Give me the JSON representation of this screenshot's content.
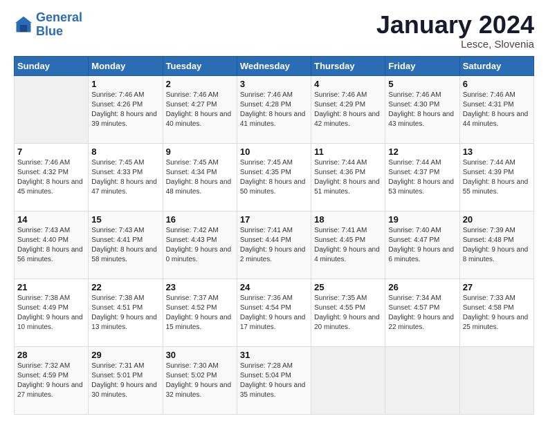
{
  "logo": {
    "line1": "General",
    "line2": "Blue"
  },
  "title": "January 2024",
  "location": "Lesce, Slovenia",
  "days_header": [
    "Sunday",
    "Monday",
    "Tuesday",
    "Wednesday",
    "Thursday",
    "Friday",
    "Saturday"
  ],
  "weeks": [
    [
      {
        "num": "",
        "sunrise": "",
        "sunset": "",
        "daylight": ""
      },
      {
        "num": "1",
        "sunrise": "Sunrise: 7:46 AM",
        "sunset": "Sunset: 4:26 PM",
        "daylight": "Daylight: 8 hours and 39 minutes."
      },
      {
        "num": "2",
        "sunrise": "Sunrise: 7:46 AM",
        "sunset": "Sunset: 4:27 PM",
        "daylight": "Daylight: 8 hours and 40 minutes."
      },
      {
        "num": "3",
        "sunrise": "Sunrise: 7:46 AM",
        "sunset": "Sunset: 4:28 PM",
        "daylight": "Daylight: 8 hours and 41 minutes."
      },
      {
        "num": "4",
        "sunrise": "Sunrise: 7:46 AM",
        "sunset": "Sunset: 4:29 PM",
        "daylight": "Daylight: 8 hours and 42 minutes."
      },
      {
        "num": "5",
        "sunrise": "Sunrise: 7:46 AM",
        "sunset": "Sunset: 4:30 PM",
        "daylight": "Daylight: 8 hours and 43 minutes."
      },
      {
        "num": "6",
        "sunrise": "Sunrise: 7:46 AM",
        "sunset": "Sunset: 4:31 PM",
        "daylight": "Daylight: 8 hours and 44 minutes."
      }
    ],
    [
      {
        "num": "7",
        "sunrise": "Sunrise: 7:46 AM",
        "sunset": "Sunset: 4:32 PM",
        "daylight": "Daylight: 8 hours and 45 minutes."
      },
      {
        "num": "8",
        "sunrise": "Sunrise: 7:45 AM",
        "sunset": "Sunset: 4:33 PM",
        "daylight": "Daylight: 8 hours and 47 minutes."
      },
      {
        "num": "9",
        "sunrise": "Sunrise: 7:45 AM",
        "sunset": "Sunset: 4:34 PM",
        "daylight": "Daylight: 8 hours and 48 minutes."
      },
      {
        "num": "10",
        "sunrise": "Sunrise: 7:45 AM",
        "sunset": "Sunset: 4:35 PM",
        "daylight": "Daylight: 8 hours and 50 minutes."
      },
      {
        "num": "11",
        "sunrise": "Sunrise: 7:44 AM",
        "sunset": "Sunset: 4:36 PM",
        "daylight": "Daylight: 8 hours and 51 minutes."
      },
      {
        "num": "12",
        "sunrise": "Sunrise: 7:44 AM",
        "sunset": "Sunset: 4:37 PM",
        "daylight": "Daylight: 8 hours and 53 minutes."
      },
      {
        "num": "13",
        "sunrise": "Sunrise: 7:44 AM",
        "sunset": "Sunset: 4:39 PM",
        "daylight": "Daylight: 8 hours and 55 minutes."
      }
    ],
    [
      {
        "num": "14",
        "sunrise": "Sunrise: 7:43 AM",
        "sunset": "Sunset: 4:40 PM",
        "daylight": "Daylight: 8 hours and 56 minutes."
      },
      {
        "num": "15",
        "sunrise": "Sunrise: 7:43 AM",
        "sunset": "Sunset: 4:41 PM",
        "daylight": "Daylight: 8 hours and 58 minutes."
      },
      {
        "num": "16",
        "sunrise": "Sunrise: 7:42 AM",
        "sunset": "Sunset: 4:43 PM",
        "daylight": "Daylight: 9 hours and 0 minutes."
      },
      {
        "num": "17",
        "sunrise": "Sunrise: 7:41 AM",
        "sunset": "Sunset: 4:44 PM",
        "daylight": "Daylight: 9 hours and 2 minutes."
      },
      {
        "num": "18",
        "sunrise": "Sunrise: 7:41 AM",
        "sunset": "Sunset: 4:45 PM",
        "daylight": "Daylight: 9 hours and 4 minutes."
      },
      {
        "num": "19",
        "sunrise": "Sunrise: 7:40 AM",
        "sunset": "Sunset: 4:47 PM",
        "daylight": "Daylight: 9 hours and 6 minutes."
      },
      {
        "num": "20",
        "sunrise": "Sunrise: 7:39 AM",
        "sunset": "Sunset: 4:48 PM",
        "daylight": "Daylight: 9 hours and 8 minutes."
      }
    ],
    [
      {
        "num": "21",
        "sunrise": "Sunrise: 7:38 AM",
        "sunset": "Sunset: 4:49 PM",
        "daylight": "Daylight: 9 hours and 10 minutes."
      },
      {
        "num": "22",
        "sunrise": "Sunrise: 7:38 AM",
        "sunset": "Sunset: 4:51 PM",
        "daylight": "Daylight: 9 hours and 13 minutes."
      },
      {
        "num": "23",
        "sunrise": "Sunrise: 7:37 AM",
        "sunset": "Sunset: 4:52 PM",
        "daylight": "Daylight: 9 hours and 15 minutes."
      },
      {
        "num": "24",
        "sunrise": "Sunrise: 7:36 AM",
        "sunset": "Sunset: 4:54 PM",
        "daylight": "Daylight: 9 hours and 17 minutes."
      },
      {
        "num": "25",
        "sunrise": "Sunrise: 7:35 AM",
        "sunset": "Sunset: 4:55 PM",
        "daylight": "Daylight: 9 hours and 20 minutes."
      },
      {
        "num": "26",
        "sunrise": "Sunrise: 7:34 AM",
        "sunset": "Sunset: 4:57 PM",
        "daylight": "Daylight: 9 hours and 22 minutes."
      },
      {
        "num": "27",
        "sunrise": "Sunrise: 7:33 AM",
        "sunset": "Sunset: 4:58 PM",
        "daylight": "Daylight: 9 hours and 25 minutes."
      }
    ],
    [
      {
        "num": "28",
        "sunrise": "Sunrise: 7:32 AM",
        "sunset": "Sunset: 4:59 PM",
        "daylight": "Daylight: 9 hours and 27 minutes."
      },
      {
        "num": "29",
        "sunrise": "Sunrise: 7:31 AM",
        "sunset": "Sunset: 5:01 PM",
        "daylight": "Daylight: 9 hours and 30 minutes."
      },
      {
        "num": "30",
        "sunrise": "Sunrise: 7:30 AM",
        "sunset": "Sunset: 5:02 PM",
        "daylight": "Daylight: 9 hours and 32 minutes."
      },
      {
        "num": "31",
        "sunrise": "Sunrise: 7:28 AM",
        "sunset": "Sunset: 5:04 PM",
        "daylight": "Daylight: 9 hours and 35 minutes."
      },
      {
        "num": "",
        "sunrise": "",
        "sunset": "",
        "daylight": ""
      },
      {
        "num": "",
        "sunrise": "",
        "sunset": "",
        "daylight": ""
      },
      {
        "num": "",
        "sunrise": "",
        "sunset": "",
        "daylight": ""
      }
    ]
  ]
}
